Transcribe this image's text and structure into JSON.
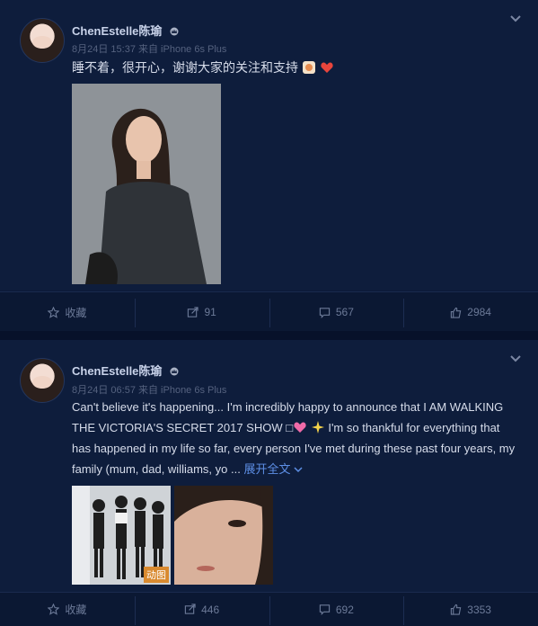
{
  "post1": {
    "username": "ChenEstelle陈瑜",
    "meta": "8月24日 15:37 来自 iPhone 6s Plus",
    "text": "睡不着，很开心，谢谢大家的关注和支持",
    "actions": {
      "favorite": "收藏",
      "repost": "91",
      "comment": "567",
      "like": "2984"
    }
  },
  "post2": {
    "username": "ChenEstelle陈瑜",
    "meta": "8月24日 06:57 来自 iPhone 6s Plus",
    "text_part1": "Can't believe it's happening... I'm incredibly happy to announce that I AM WALKING THE VICTORIA'S SECRET 2017 SHOW □",
    "text_part2": " I'm so thankful for everything that has happened in my life so far, every person I've met during these past four years, my family (mum, dad, williams, yo ... ",
    "expand_label": "展开全文",
    "gif_tag": "动图",
    "actions": {
      "favorite": "收藏",
      "repost": "446",
      "comment": "692",
      "like": "3353"
    }
  }
}
